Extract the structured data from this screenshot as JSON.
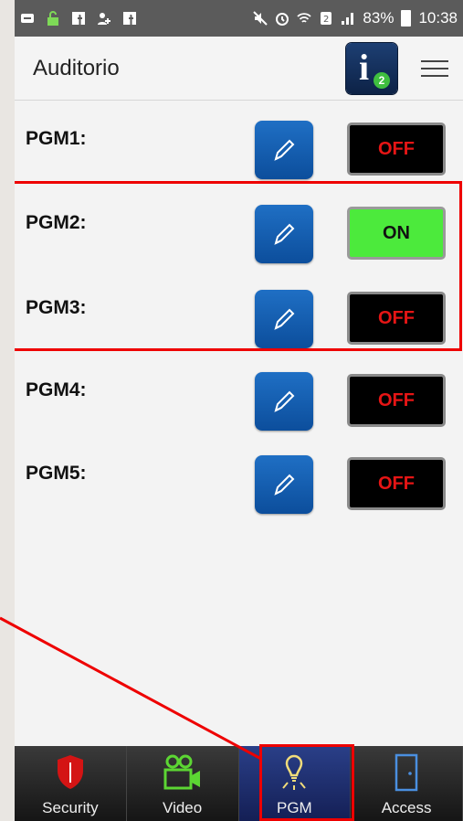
{
  "statusbar": {
    "battery": "83%",
    "time": "10:38"
  },
  "header": {
    "title": "Auditorio",
    "info_badge": "2"
  },
  "pgms": [
    {
      "label": "PGM1:",
      "state": "OFF"
    },
    {
      "label": "PGM2:",
      "state": "ON"
    },
    {
      "label": "PGM3:",
      "state": "OFF"
    },
    {
      "label": "PGM4:",
      "state": "OFF"
    },
    {
      "label": "PGM5:",
      "state": "OFF"
    }
  ],
  "nav": [
    {
      "label": "Security",
      "icon": "shield-icon"
    },
    {
      "label": "Video",
      "icon": "video-camera-icon"
    },
    {
      "label": "PGM",
      "icon": "light-bulb-icon",
      "active": true
    },
    {
      "label": "Access",
      "icon": "door-icon"
    }
  ],
  "colors": {
    "on": "#4cea3c",
    "off_text": "#e61515",
    "highlight": "#e00000",
    "brand_blue": "#0c4e9c"
  }
}
